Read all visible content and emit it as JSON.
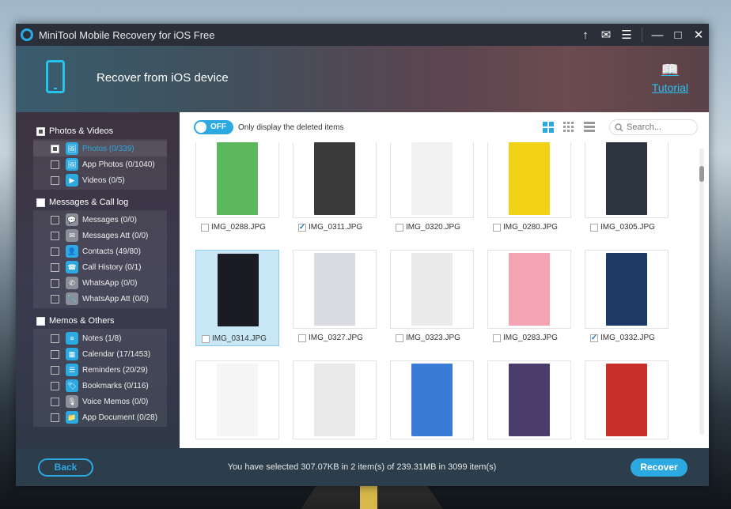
{
  "app": {
    "title": "MiniTool Mobile Recovery for iOS Free"
  },
  "titlebar": {
    "upload_icon": "↑",
    "mail_icon": "✉",
    "menu_icon": "☰",
    "minimize_icon": "—",
    "maximize_icon": "□",
    "close_icon": "✕"
  },
  "header": {
    "title": "Recover from iOS device",
    "tutorial_label": "Tutorial",
    "tutorial_icon": "📖"
  },
  "sidebar": {
    "groups": [
      {
        "label": "Photos & Videos",
        "items": [
          {
            "label": "Photos (0/339)",
            "icon": "🖼"
          },
          {
            "label": "App Photos (0/1040)",
            "icon": "🖼"
          },
          {
            "label": "Videos (0/5)",
            "icon": "▶"
          }
        ]
      },
      {
        "label": "Messages & Call log",
        "items": [
          {
            "label": "Messages (0/0)",
            "icon": "💬"
          },
          {
            "label": "Messages Att (0/0)",
            "icon": "✉"
          },
          {
            "label": "Contacts (49/80)",
            "icon": "👤"
          },
          {
            "label": "Call History (0/1)",
            "icon": "☎"
          },
          {
            "label": "WhatsApp (0/0)",
            "icon": "✆"
          },
          {
            "label": "WhatsApp Att (0/0)",
            "icon": "📎"
          }
        ]
      },
      {
        "label": "Memos & Others",
        "items": [
          {
            "label": "Notes (1/8)",
            "icon": "≡"
          },
          {
            "label": "Calendar (17/1453)",
            "icon": "▦"
          },
          {
            "label": "Reminders (20/29)",
            "icon": "☰"
          },
          {
            "label": "Bookmarks (0/116)",
            "icon": "🏷"
          },
          {
            "label": "Voice Memos (0/0)",
            "icon": "🎙"
          },
          {
            "label": "App Document (0/28)",
            "icon": "📁"
          }
        ]
      }
    ]
  },
  "toolbar": {
    "toggle_state": "OFF",
    "toggle_label": "Only display the deleted items",
    "search_placeholder": "Search..."
  },
  "files": [
    {
      "name": "IMG_0288.JPG",
      "color": "#5cb85c",
      "checked": false
    },
    {
      "name": "IMG_0311.JPG",
      "color": "#3a3a3a",
      "checked": true
    },
    {
      "name": "IMG_0320.JPG",
      "color": "#f2f2f2",
      "checked": false
    },
    {
      "name": "IMG_0280.JPG",
      "color": "#f1d216",
      "checked": false
    },
    {
      "name": "IMG_0305.JPG",
      "color": "#2c3440",
      "checked": false
    },
    {
      "name": "IMG_0314.JPG",
      "color": "#1b1b24",
      "checked": false
    },
    {
      "name": "IMG_0327.JPG",
      "color": "#d9dbe0",
      "checked": false
    },
    {
      "name": "IMG_0323.JPG",
      "color": "#eaeaea",
      "checked": false
    },
    {
      "name": "IMG_0283.JPG",
      "color": "#f4a3b2",
      "checked": false
    },
    {
      "name": "IMG_0332.JPG",
      "color": "#1d3b66",
      "checked": true
    },
    {
      "name": "",
      "color": "#f5f5f5",
      "checked": false
    },
    {
      "name": "",
      "color": "#e9e9e9",
      "checked": false
    },
    {
      "name": "",
      "color": "#3a7bd5",
      "checked": false
    },
    {
      "name": "",
      "color": "#4a3d6b",
      "checked": false
    },
    {
      "name": "",
      "color": "#c9302c",
      "checked": false
    }
  ],
  "footer": {
    "back_label": "Back",
    "status": "You have selected 307.07KB in 2 item(s) of 239.31MB in 3099 item(s)",
    "recover_label": "Recover"
  },
  "colors": {
    "accent": "#2ca9e1"
  }
}
